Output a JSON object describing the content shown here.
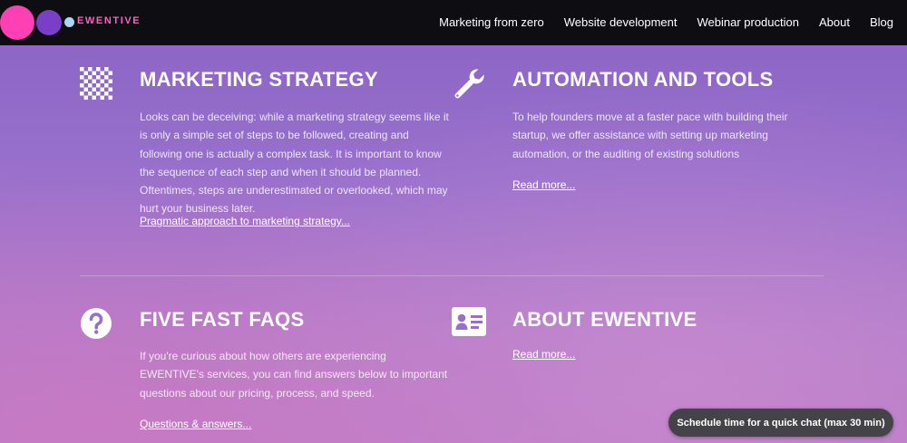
{
  "header": {
    "logo_text": "EWENTIVE",
    "nav": [
      {
        "label": "Marketing from zero"
      },
      {
        "label": "Website development"
      },
      {
        "label": "Webinar production"
      },
      {
        "label": "About"
      },
      {
        "label": "Blog"
      }
    ]
  },
  "sections": {
    "strategy": {
      "icon": "checkerboard-icon",
      "title": "MARKETING STRATEGY",
      "body": "Looks can be deceiving: while a marketing strategy seems like it is only a simple set of steps to be followed, creating and following one is actually a complex task. It is important to know the sequence of each step and when it should be planned. Oftentimes, steps are underestimated or overlooked, which may hurt your business later.",
      "link": "Pragmatic approach to marketing strategy..."
    },
    "automation": {
      "icon": "wrench-icon",
      "title": "AUTOMATION AND TOOLS",
      "body": "To help founders move at a faster pace with building their startup, we offer assistance with setting up marketing automation, or the auditing of existing solutions",
      "link": "Read more..."
    },
    "faqs": {
      "icon": "question-circle-icon",
      "title": "FIVE FAST FAQS",
      "body": "If you're curious about how others are experiencing EWENTIVE's services, you can find answers below to important questions about our pricing, process, and speed.",
      "link": "Questions & answers..."
    },
    "about": {
      "icon": "id-card-icon",
      "title": "ABOUT EWENTIVE",
      "link": "Read more..."
    }
  },
  "chat_button": {
    "label": "Schedule time for a quick chat (max 30 min)"
  },
  "colors": {
    "header_bg": "#0e0e12",
    "logo_pink": "#ff3fb4",
    "logo_purple": "#7a3fc8",
    "logo_blue": "#a9d6ff",
    "chat_bg": "#444448"
  }
}
